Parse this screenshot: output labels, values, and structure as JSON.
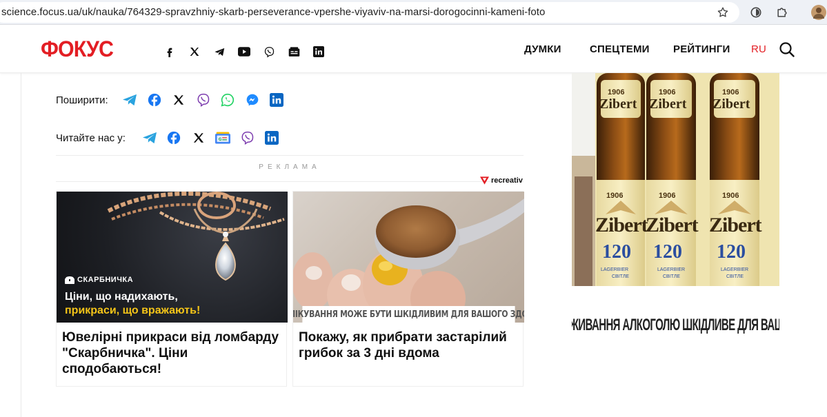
{
  "browser": {
    "url": "science.focus.ua/uk/nauka/764329-spravzhniy-skarb-perseverance-vpershe-viyaviv-na-marsi-dorogocinni-kameni-foto"
  },
  "header": {
    "logo": "ФОКУС",
    "social": [
      "facebook-icon",
      "x-icon",
      "telegram-icon",
      "youtube-icon",
      "viber-icon",
      "google-news-icon",
      "linkedin-icon"
    ],
    "nav": [
      {
        "label": "ДУМКИ"
      },
      {
        "label": "СПЕЦТЕМИ"
      },
      {
        "label": "РЕЙТИНГИ"
      }
    ],
    "lang": "RU"
  },
  "share": {
    "label": "Поширити:",
    "icons": [
      "telegram-icon",
      "facebook-icon",
      "x-icon",
      "viber-icon",
      "whatsapp-icon",
      "messenger-icon",
      "linkedin-icon"
    ]
  },
  "read_us": {
    "label": "Читайте нас у:",
    "icons": [
      "telegram-icon",
      "facebook-icon",
      "x-icon",
      "google-news-icon",
      "viber-icon",
      "linkedin-icon"
    ]
  },
  "ad": {
    "label": "РЕКЛАМА",
    "network": "recreativ",
    "cards": [
      {
        "brand": "СКАРБНИЧКА",
        "promo_line1": "Ціни, що надихають,",
        "promo_line2": "прикраси, що вражають!",
        "title": "Ювелірні прикраси від ломбарду \"Скарбничка\". Ціни сподобаються!"
      },
      {
        "warning": "САМОЛІКУВАННЯ МОЖЕ БУТИ ШКІДЛИВИМ ДЛЯ ВАШОГО ЗДОРОВ'Я",
        "title": "Покажу, як прибрати застарілий грибок за 3 дні вдома"
      }
    ],
    "side": {
      "brand": "Zibert",
      "year": "1906",
      "number": "120",
      "style": "LAGERBIER",
      "sub": "СВІТЛЕ",
      "warning": "НАДМІРНЕ СПОЖИВАННЯ АЛКОГОЛЮ ШКІДЛИВЕ ДЛЯ ВАШОГО ЗДОРОВ'Я"
    }
  },
  "colors": {
    "brand_red": "#e31e24",
    "telegram": "#2aa3df",
    "facebook": "#1877f2",
    "viber": "#7d3daf",
    "whatsapp": "#25d366",
    "messenger": "#1f8bff",
    "linkedin": "#0a66c2"
  }
}
